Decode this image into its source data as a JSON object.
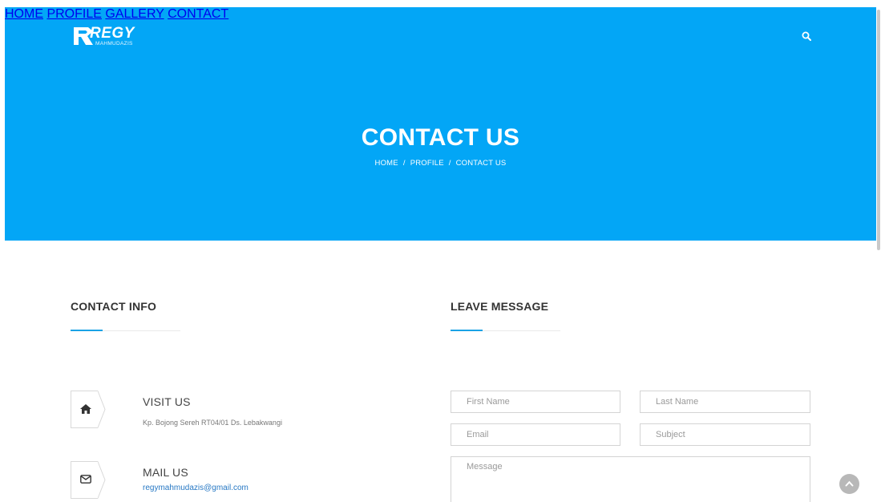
{
  "logo": {
    "main": "REGY",
    "sub": "MAHMUDAZIS"
  },
  "nav": {
    "home": "HOME",
    "profile": "PROFILE",
    "gallery": "GALLERY",
    "contact": "CONTACT"
  },
  "hero": {
    "title": "CONTACT US",
    "breadcrumb": {
      "home": "HOME",
      "profile": "PROFILE",
      "current": "CONTACT US",
      "separator": "/"
    }
  },
  "contact_info": {
    "title": "CONTACT INFO",
    "visit": {
      "title": "VISIT US",
      "text": "Kp. Bojong Sereh RT04/01 Ds. Lebakwangi"
    },
    "mail": {
      "title": "MAIL US",
      "text": "regymahmudazis@gmail.com"
    }
  },
  "form": {
    "title": "LEAVE MESSAGE",
    "first_name_placeholder": "First Name",
    "last_name_placeholder": "Last Name",
    "email_placeholder": "Email",
    "subject_placeholder": "Subject",
    "message_placeholder": "Message"
  },
  "colors": {
    "brand": "#03a6f6",
    "accent": "#1aa3e5",
    "link": "#2778c4"
  }
}
